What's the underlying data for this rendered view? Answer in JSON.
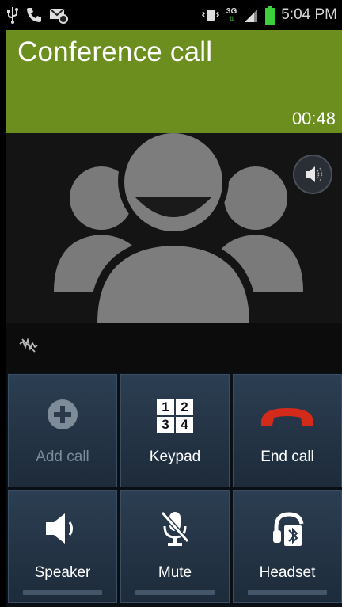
{
  "status_bar": {
    "time": "5:04 PM",
    "network_label": "3G",
    "icons": [
      "usb-icon",
      "phone-icon",
      "voicemail-icon",
      "vibrate-icon",
      "network-3g-icon",
      "signal-icon",
      "battery-icon"
    ]
  },
  "call": {
    "title": "Conference call",
    "duration": "00:48"
  },
  "buttons": {
    "add_call": "Add call",
    "keypad": "Keypad",
    "end_call": "End call",
    "speaker": "Speaker",
    "mute": "Mute",
    "headset": "Headset"
  },
  "keypad_digits": [
    "1",
    "2",
    "3",
    "4"
  ],
  "colors": {
    "header": "#6b8e1e",
    "end_call": "#d42a1a",
    "button_bg": "#2c3e52"
  }
}
